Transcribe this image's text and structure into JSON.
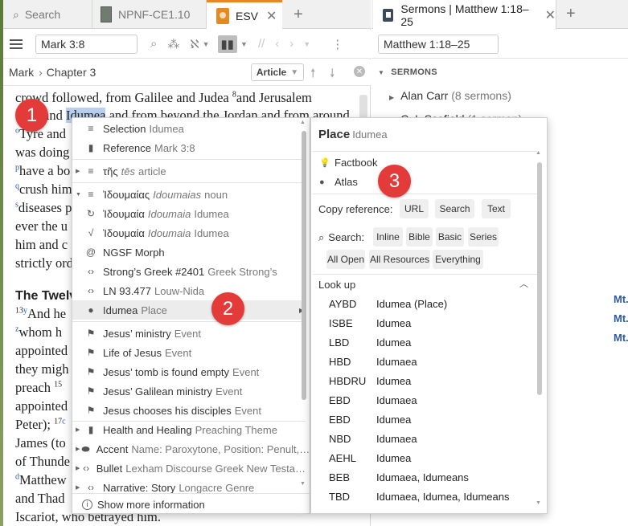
{
  "left_tabs": {
    "search": "Search",
    "nrpf": "NPNF-CE1.10",
    "esv": "ESV",
    "esv_close": "✕",
    "add": "+"
  },
  "toolbar": {
    "reference": "Mark 3:8"
  },
  "breadcrumb": {
    "book": "Mark",
    "separator": "›",
    "chapter": "Chapter 3",
    "article_btn": "Article"
  },
  "bible_text": {
    "l1": "crowd followed, from Galilee and Judea ",
    "l1_sup": "8",
    "l1b": "and Jerusalem",
    "l2a": "and ",
    "l2_hl": "Idumea",
    "l2b": " and from beyond the Jordan and from around",
    "l3_sup": "o",
    "l3": "Tyre and",
    "l4": "was doing",
    "l5_sup": "p",
    "l5": "have a bo",
    "l6_sup": "q",
    "l6": "crush him",
    "l7_sup": "s",
    "l7": "diseases p",
    "l8": "ever the u",
    "l9": "him and c",
    "l10": "strictly ord",
    "heading": "The Twelv",
    "l11_sup": "13",
    "l11_sup2": "y",
    "l11": "And he",
    "l12_sup": "z",
    "l12": "whom h",
    "l13": "appointed",
    "l14": "they migh",
    "l15": "preach ",
    "l15_sup": "15",
    "l16": "appointed",
    "l17": "Peter); ",
    "l17_sup": "17",
    "l17_sup2": "c",
    "l18": "James (to",
    "l19": "of Thunde",
    "l20_sup": "d",
    "l20": "Matthew",
    "l21": "and Thad",
    "l22": "Iscariot, who betrayed him."
  },
  "right_tabs": {
    "title": "Sermons | Matthew 1:18–25",
    "close": "✕",
    "add": "+"
  },
  "right_toolbar": {
    "reference": "Matthew 1:18–25"
  },
  "sermons": {
    "heading": "SERMONS",
    "items": [
      {
        "name": "Alan Carr",
        "count": "(8 sermons)"
      },
      {
        "name": "C. I. Scofield",
        "count": "(1 sermon)"
      }
    ],
    "refs": [
      "Mt.",
      "Mt.",
      "Mt."
    ]
  },
  "context_menu": {
    "items": [
      {
        "label": "Selection",
        "extra": "Idumea",
        "icon": "list-icon"
      },
      {
        "label": "Reference",
        "extra": "Mark 3:8",
        "icon": "bookmark-icon"
      },
      {
        "label": "τῆς",
        "extra_italic": "tēs",
        "extra": "article",
        "icon": "list-icon",
        "arrow": "▶"
      },
      {
        "label": "Ἰδουμαίας",
        "extra_italic": "Idoumaias",
        "extra": "noun",
        "icon": "list-icon",
        "arrow": "▼"
      },
      {
        "label": "Ἰδουμαία",
        "extra_italic": "Idoumaia",
        "extra": "Idumea",
        "icon": "lemma-icon"
      },
      {
        "label": "Ἰδουμαία",
        "extra_italic": "Idoumaia",
        "extra": "Idumea",
        "icon": "root-icon"
      },
      {
        "label": "NGSF Morph",
        "extra": "",
        "icon": "morph-icon"
      },
      {
        "label": "Strong’s Greek #2401",
        "extra": "Greek Strong’s",
        "icon": "code-icon"
      },
      {
        "label": "LN 93.477",
        "extra": "Louw-Nida",
        "icon": "code-icon"
      },
      {
        "label": "Idumea",
        "extra": "Place",
        "icon": "pin-icon"
      },
      {
        "label": "Jesus’ ministry",
        "extra": "Event",
        "icon": "flag-icon"
      },
      {
        "label": "Life of Jesus",
        "extra": "Event",
        "icon": "flag-icon"
      },
      {
        "label": "Jesus’ tomb is found empty",
        "extra": "Event",
        "icon": "flag-icon"
      },
      {
        "label": "Jesus’ Galilean ministry",
        "extra": "Event",
        "icon": "flag-icon"
      },
      {
        "label": "Jesus chooses his disciples",
        "extra": "Event",
        "icon": "flag-icon"
      },
      {
        "label": "Health and Healing",
        "extra": "Preaching Theme",
        "icon": "book-icon",
        "arrow": "▶"
      },
      {
        "label": "Accent",
        "extra": "Name: Paroxytone, Position: Penult,…",
        "icon": "tag-icon",
        "arrow": "▶"
      },
      {
        "label": "Bullet",
        "extra": "Lexham Discourse Greek New Testa…",
        "icon": "code-icon",
        "arrow": "▶"
      },
      {
        "label": "Narrative: Story",
        "extra": "Longacre Genre",
        "icon": "code-icon",
        "arrow": "▶"
      }
    ],
    "show_more": "Show more information",
    "submenu_caret": "▶"
  },
  "place_panel": {
    "title": "Place",
    "title_sub": "Idumea",
    "factbook": "Factbook",
    "atlas": "Atlas",
    "copy_label": "Copy reference:",
    "copy_buttons": [
      "URL",
      "Search",
      "Text"
    ],
    "search_label": "Search:",
    "search_row1": [
      "Inline",
      "Bible",
      "Basic",
      "Series"
    ],
    "search_row2": [
      "All Open",
      "All Resources",
      "Everything"
    ],
    "lookup_heading": "Look up",
    "lookup": [
      {
        "abbr": "AYBD",
        "value": "Idumea (Place)"
      },
      {
        "abbr": "ISBE",
        "value": "Idumea"
      },
      {
        "abbr": "LBD",
        "value": "Idumea"
      },
      {
        "abbr": "HBD",
        "value": "Idumaea"
      },
      {
        "abbr": "HBDRU",
        "value": "Idumea"
      },
      {
        "abbr": "EBD",
        "value": "Idumaea"
      },
      {
        "abbr": "EBD",
        "value": "Idumea"
      },
      {
        "abbr": "NBD",
        "value": "Idumaea"
      },
      {
        "abbr": "AEHL",
        "value": "Idumea"
      },
      {
        "abbr": "BEB",
        "value": "Idumaea, Idumeans"
      },
      {
        "abbr": "TBD",
        "value": "Idumaea, Idumea, Idumeans"
      }
    ]
  },
  "callouts": [
    "1",
    "2",
    "3"
  ],
  "colors": {
    "accent_orange": "#e58a1f",
    "callout_red": "#e33a3a",
    "link_blue": "#2a5aa8",
    "highlight": "#b8d0ee"
  }
}
